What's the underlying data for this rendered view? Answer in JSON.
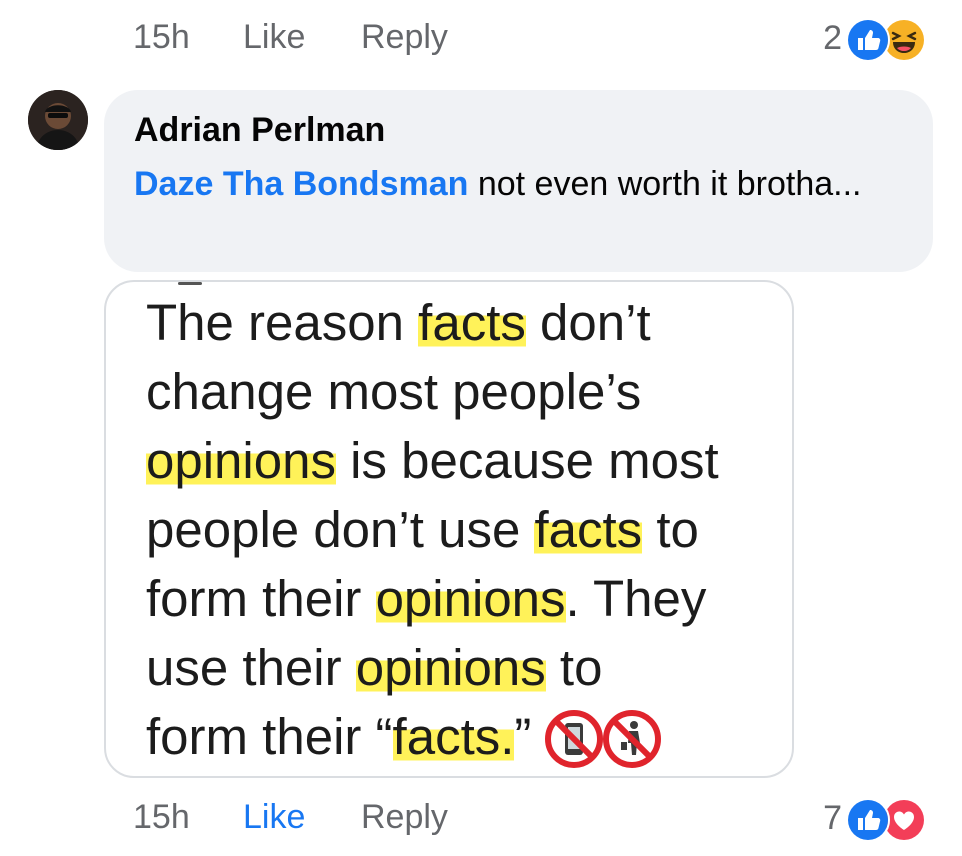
{
  "top_actions": {
    "time": "15h",
    "like": "Like",
    "reply": "Reply",
    "reaction_count": "2",
    "reaction_icons": [
      "like-icon",
      "haha-icon"
    ]
  },
  "comment": {
    "author": "Adrian Perlman",
    "mention": "Daze Tha Bondsman",
    "text": " not even worth it brotha...",
    "image": {
      "lines": [
        [
          {
            "t": "The reason "
          },
          {
            "t": "facts",
            "hl": true
          },
          {
            "t": " don’t"
          }
        ],
        [
          {
            "t": "change most people’s"
          }
        ],
        [
          {
            "t": "opinions",
            "hl": true
          },
          {
            "t": " is because most"
          }
        ],
        [
          {
            "t": "people don’t use "
          },
          {
            "t": "facts",
            "hl": true
          },
          {
            "t": " to"
          }
        ],
        [
          {
            "t": "form their "
          },
          {
            "t": "opinions",
            "hl": true
          },
          {
            "t": ". They"
          }
        ],
        [
          {
            "t": "use their "
          },
          {
            "t": "opinions",
            "hl": true
          },
          {
            "t": " to"
          }
        ],
        [
          {
            "t": "form their “"
          },
          {
            "t": "facts.",
            "hl": true
          },
          {
            "t": "”"
          }
        ]
      ],
      "trailing_emoji": [
        "no-mobile-phones-icon",
        "no-littering-icon"
      ]
    }
  },
  "bottom_actions": {
    "time": "15h",
    "like": "Like",
    "reply": "Reply",
    "reaction_count": "7",
    "reaction_icons": [
      "like-icon",
      "love-icon"
    ]
  },
  "colors": {
    "link_blue": "#1877f2",
    "muted_gray": "#65676b",
    "bubble_bg": "#f0f2f5",
    "highlight_yellow": "#fff03c",
    "love_red": "#f33e58"
  }
}
